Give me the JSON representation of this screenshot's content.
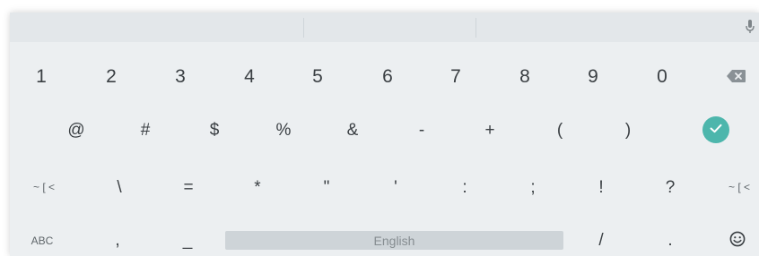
{
  "keyboard": {
    "row1": [
      "1",
      "2",
      "3",
      "4",
      "5",
      "6",
      "7",
      "8",
      "9",
      "0"
    ],
    "row2": [
      "@",
      "#",
      "$",
      "%",
      "&",
      "-",
      "+",
      "(",
      ")"
    ],
    "row3_more_left": "~ [ <",
    "row3": [
      "\\",
      "=",
      "*",
      "\"",
      "'",
      ":",
      ";",
      "!",
      "?"
    ],
    "row3_more_right": "~ [ <",
    "row4": {
      "abc": "ABC",
      "comma": ",",
      "underscore": "_",
      "space": "English",
      "slash": "/",
      "period": "."
    },
    "icons": {
      "mic": "mic-icon",
      "backspace": "backspace-icon",
      "enter": "checkmark-icon",
      "emoji": "emoji-icon"
    },
    "colors": {
      "accent": "#4db6ac",
      "background": "#eceff1",
      "suggestion_bar": "#e3e7ea",
      "spacebar": "#ced4d8"
    }
  }
}
